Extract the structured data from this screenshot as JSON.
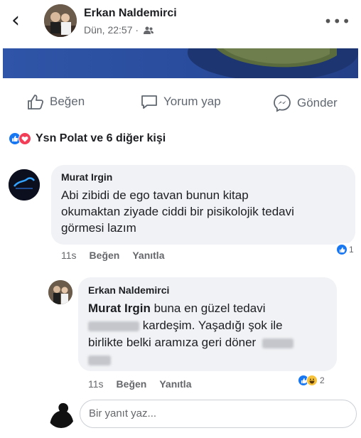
{
  "post": {
    "author": "Erkan Naldemirci",
    "time": "Dün, 22:57 ·",
    "audience_icon": "friends-icon",
    "more_icon": "more-options-icon"
  },
  "actions": {
    "like": "Beğen",
    "comment": "Yorum yap",
    "send": "Gönder"
  },
  "reactions": {
    "summary": "Ysn Polat ve 6 diğer kişi",
    "icons": [
      "like-icon",
      "love-icon"
    ]
  },
  "comments": [
    {
      "author": "Murat Irgin",
      "lines": [
        "Abi zibidi de ego tavan bunun kitap",
        "okumaktan ziyade ciddi bir pisikolojik tedavi",
        "görmesi lazım"
      ],
      "time": "11s",
      "like": "Beğen",
      "reply": "Yanıtla",
      "reaction_count": "1"
    },
    {
      "author": "Erkan Naldemirci",
      "mention": "Murat Irgin",
      "line1_rest": " buna en güzel tedavi",
      "line2_rest": "kardeşim. Yaşadığı şok ile",
      "line3": "birlikte belki aramıza geri döner",
      "time": "11s",
      "like": "Beğen",
      "reply": "Yanıtla",
      "reaction_count": "2"
    }
  ],
  "reply_box": {
    "placeholder": "Bir yanıt yaz..."
  },
  "colors": {
    "brand_blue": "#1877f2",
    "love_red": "#f33e58",
    "bubble_bg": "#f0f2f5"
  }
}
